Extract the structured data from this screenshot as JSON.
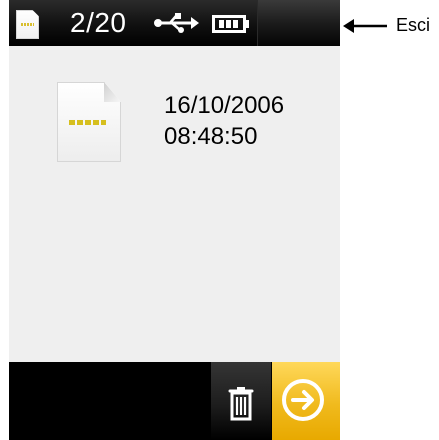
{
  "header": {
    "counter": "2/20",
    "icons": {
      "document": "document-icon",
      "usb": "usb-icon",
      "battery": "battery-icon",
      "close": "close-icon"
    }
  },
  "main": {
    "date": "16/10/2006",
    "time": "08:48:50",
    "icon": "document-icon"
  },
  "footer": {
    "icons": {
      "trash": "trash-icon",
      "next": "arrow-right-icon"
    }
  },
  "annotation": {
    "label": "Esci",
    "icon": "arrow-left-icon"
  },
  "colors": {
    "accent": "#f0ba1d",
    "document_mark": "#d6bf1e"
  }
}
